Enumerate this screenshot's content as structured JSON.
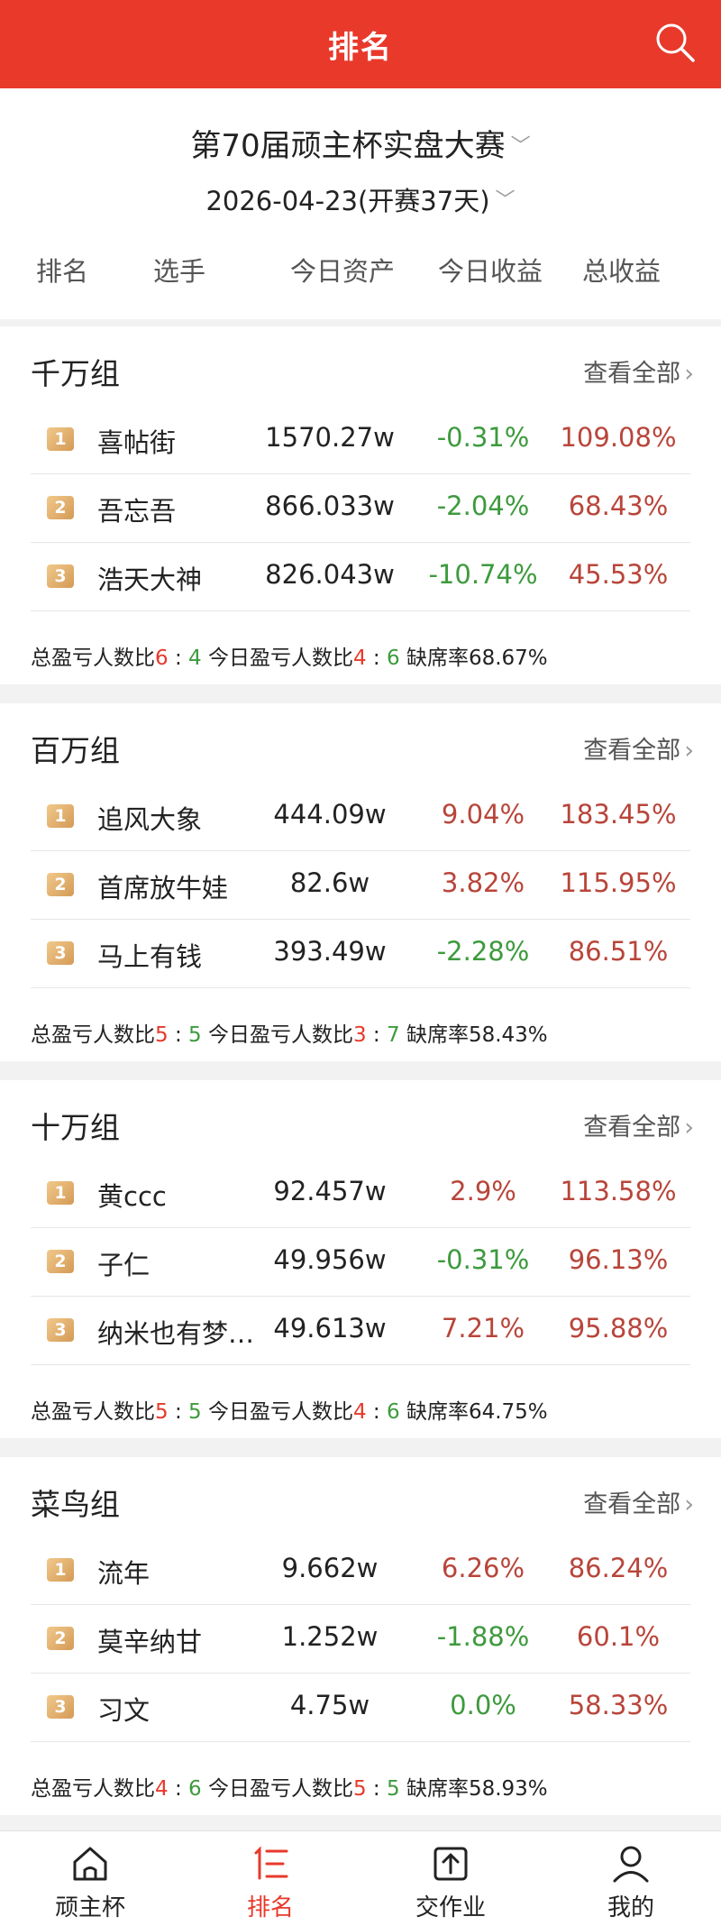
{
  "header": {
    "title": "排名"
  },
  "contest": {
    "name": "第70届顽主杯实盘大赛",
    "date": "2026-04-23(开赛37天)"
  },
  "columns": {
    "rank": "排名",
    "player": "选手",
    "asset": "今日资产",
    "today": "今日收益",
    "total": "总收益"
  },
  "view_all": "查看全部",
  "groups": [
    {
      "name": "千万组",
      "rows": [
        {
          "rank": "1",
          "name": "喜帖街",
          "asset": "1570.27w",
          "today": "-0.31%",
          "total": "109.08%"
        },
        {
          "rank": "2",
          "name": "吾忘吾",
          "asset": "866.033w",
          "today": "-2.04%",
          "total": "68.43%"
        },
        {
          "rank": "3",
          "name": "浩天大神",
          "asset": "826.043w",
          "today": "-10.74%",
          "total": "45.53%"
        }
      ],
      "stats": {
        "total_label": "总盈亏人数比",
        "total_win": "6",
        "total_lose": "4",
        "today_label": "今日盈亏人数比",
        "today_win": "4",
        "today_lose": "6",
        "absent": "缺席率68.67%"
      }
    },
    {
      "name": "百万组",
      "rows": [
        {
          "rank": "1",
          "name": "追风大象",
          "asset": "444.09w",
          "today": "9.04%",
          "total": "183.45%"
        },
        {
          "rank": "2",
          "name": "首席放牛娃",
          "asset": "82.6w",
          "today": "3.82%",
          "total": "115.95%"
        },
        {
          "rank": "3",
          "name": "马上有钱",
          "asset": "393.49w",
          "today": "-2.28%",
          "total": "86.51%"
        }
      ],
      "stats": {
        "total_label": "总盈亏人数比",
        "total_win": "5",
        "total_lose": "5",
        "today_label": "今日盈亏人数比",
        "today_win": "3",
        "today_lose": "7",
        "absent": "缺席率58.43%"
      }
    },
    {
      "name": "十万组",
      "rows": [
        {
          "rank": "1",
          "name": "黄ccc",
          "asset": "92.457w",
          "today": "2.9%",
          "total": "113.58%"
        },
        {
          "rank": "2",
          "name": "子仁",
          "asset": "49.956w",
          "today": "-0.31%",
          "total": "96.13%"
        },
        {
          "rank": "3",
          "name": "纳米也有梦…",
          "asset": "49.613w",
          "today": "7.21%",
          "total": "95.88%"
        }
      ],
      "stats": {
        "total_label": "总盈亏人数比",
        "total_win": "5",
        "total_lose": "5",
        "today_label": "今日盈亏人数比",
        "today_win": "4",
        "today_lose": "6",
        "absent": "缺席率64.75%"
      }
    },
    {
      "name": "菜鸟组",
      "rows": [
        {
          "rank": "1",
          "name": "流年",
          "asset": "9.662w",
          "today": "6.26%",
          "total": "86.24%"
        },
        {
          "rank": "2",
          "name": "莫辛纳甘",
          "asset": "1.252w",
          "today": "-1.88%",
          "total": "60.1%"
        },
        {
          "rank": "3",
          "name": "习文",
          "asset": "4.75w",
          "today": "0.0%",
          "total": "58.33%"
        }
      ],
      "stats": {
        "total_label": "总盈亏人数比",
        "total_win": "4",
        "total_lose": "6",
        "today_label": "今日盈亏人数比",
        "today_win": "5",
        "today_lose": "5",
        "absent": "缺席率58.93%"
      }
    }
  ],
  "nav": [
    {
      "label": "顽主杯",
      "icon": "home-icon"
    },
    {
      "label": "排名",
      "icon": "ranking-icon"
    },
    {
      "label": "交作业",
      "icon": "upload-icon"
    },
    {
      "label": "我的",
      "icon": "profile-icon"
    }
  ],
  "colors": {
    "brand_red": "#e8392b",
    "gain_red": "#b8453a",
    "loss_green": "#3d9a3d"
  }
}
